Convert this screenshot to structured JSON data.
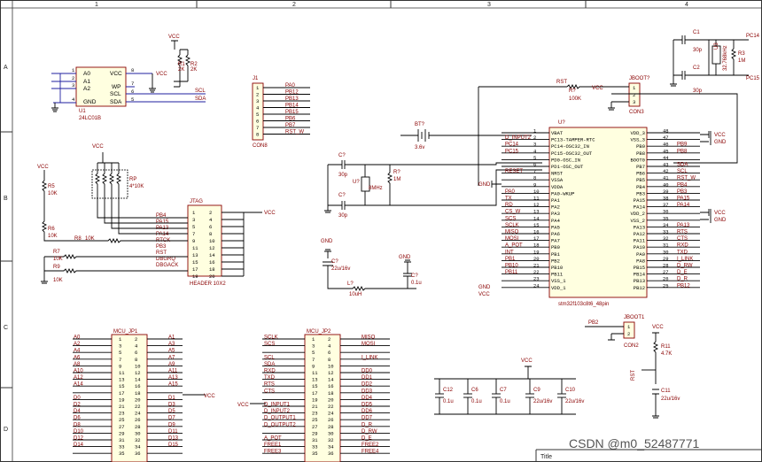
{
  "frame": {
    "col_labels": [
      "1",
      "2",
      "3",
      "4"
    ],
    "row_labels": [
      "A",
      "B",
      "C",
      "D"
    ],
    "title_label": "Title"
  },
  "watermark": "CSDN @m0_52487771",
  "eeprom": {
    "ref": "U1",
    "part": "24LC01B",
    "pins_left": [
      "A0",
      "A1",
      "A2",
      "GND"
    ],
    "pins_right": [
      "VCC",
      "WP",
      "SCL",
      "SDA"
    ],
    "pin_nums": [
      "1",
      "2",
      "3",
      "4",
      "8",
      "7",
      "6",
      "5"
    ],
    "r1": "R1",
    "r1v": "2K",
    "r2": "R2",
    "r2v": "2K",
    "nets": [
      "SCL",
      "SDA"
    ],
    "vcc": "VCC",
    "vcc2": "VCC"
  },
  "j1": {
    "ref": "J1",
    "part": "CON8",
    "pins": [
      "1",
      "2",
      "3",
      "4",
      "5",
      "6",
      "7",
      "8"
    ],
    "nets": [
      "PA0",
      "PB12",
      "PB13",
      "PB14",
      "PB15",
      "PB6",
      "PB7",
      "RST_W"
    ]
  },
  "battery": {
    "ref": "BT?",
    "value": "3.6v"
  },
  "crystal32": {
    "c1": "C1",
    "c1v": "30p",
    "c2": "C2",
    "c2v": "30p",
    "y": "U3",
    "yv": "32.768kHz",
    "r": "R3",
    "rv": "1M",
    "nets": [
      "PC14",
      "PC15"
    ]
  },
  "crystal8": {
    "c1": "C?",
    "c1v": "30p",
    "c2": "C?",
    "c2v": "30p",
    "y": "U?",
    "yv": "8MHz",
    "r": "R?",
    "rv": "1M"
  },
  "boot": {
    "ref": "JBOOT?",
    "part": "CON3",
    "r": "R?",
    "rv": "100K",
    "rst": "RST",
    "pins": [
      "1",
      "2",
      "3"
    ],
    "vcc": "VCC",
    "gnd": "GND"
  },
  "boot1": {
    "ref": "JBOOT1",
    "part": "CON2",
    "net": "PB2",
    "pins": [
      "1",
      "2"
    ]
  },
  "mcu": {
    "ref": "U?",
    "part": "stm32f103c8t6_48pin",
    "left_pins": [
      "VBAT",
      "PC13-TAMPER-RTC",
      "PC14-OSC32_IN",
      "PC15-OSC32_OUT",
      "PD0-OSC_IN",
      "PD1-OSC_OUT",
      "NRST",
      "VSSA",
      "VDDA",
      "PA0-WKUP",
      "PA1",
      "PA2",
      "PA3",
      "PA4",
      "PA5",
      "PA6",
      "PA7",
      "PB0",
      "PB1",
      "PB2",
      "PB10",
      "PB11",
      "VSS_1",
      "VDD_1"
    ],
    "left_nums": [
      "1",
      "2",
      "3",
      "4",
      "5",
      "6",
      "7",
      "8",
      "9",
      "10",
      "11",
      "12",
      "13",
      "14",
      "15",
      "16",
      "17",
      "18",
      "19",
      "20",
      "21",
      "22",
      "23",
      "24"
    ],
    "left_nets": [
      "",
      "D_INPUT2",
      "PC14",
      "PC15",
      "",
      "",
      "RESET",
      "",
      "",
      "PA0",
      "TX",
      "RD",
      "CS_W",
      "SCS",
      "SCLK",
      "MISO",
      "MOSI",
      "A_POT",
      "INT",
      "PB1",
      "PB10",
      "PB11",
      "",
      ""
    ],
    "right_pins": [
      "VDD_3",
      "VSS_3",
      "PB9",
      "PB8",
      "BOOT0",
      "PB7",
      "PB6",
      "PB5",
      "PB4",
      "PB3",
      "PA15",
      "PA14",
      "VDD_2",
      "VSS_2",
      "PA13",
      "PA12",
      "PA11",
      "PA10",
      "PA9",
      "PA8",
      "PB15",
      "PB14",
      "PB13",
      "PB12"
    ],
    "right_nums": [
      "48",
      "47",
      "46",
      "45",
      "44",
      "43",
      "42",
      "41",
      "40",
      "39",
      "38",
      "37",
      "36",
      "35",
      "34",
      "33",
      "32",
      "31",
      "30",
      "29",
      "28",
      "27",
      "26",
      "25"
    ],
    "right_nets": [
      "",
      "",
      "PB9",
      "PB8",
      "",
      "SDA",
      "SCL",
      "RST_W",
      "PB4",
      "PB3",
      "PA15",
      "PA14",
      "",
      "",
      "PA13",
      "RTS",
      "CTS",
      "RXD",
      "TXD",
      "I_LINK",
      "D_RW",
      "D_E",
      "D_R",
      "PB12"
    ],
    "vcc": "VCC",
    "gnd": "GND"
  },
  "jtag": {
    "ref": "JTAG",
    "part": "HEADER 10X2",
    "rp": "RP",
    "rpv": "4*10K",
    "r5": "R5",
    "r5v": "10K",
    "r6": "R6",
    "r6v": "10K",
    "r7": "R7",
    "r7v": "10K",
    "r8": "R8",
    "r8v": "10K",
    "r9": "R9",
    "r9v": "10K",
    "nets": [
      "PB4",
      "PA15",
      "PA13",
      "PA14",
      "RTCK",
      "PB3",
      "RST",
      "DBGRQ",
      "DBGACK"
    ],
    "nums_l": [
      "1",
      "3",
      "5",
      "7",
      "9",
      "11",
      "13",
      "15",
      "17",
      "19"
    ],
    "nums_r": [
      "2",
      "4",
      "6",
      "8",
      "10",
      "12",
      "14",
      "16",
      "18",
      "20"
    ],
    "vcc": "VCC",
    "vcc2": "VCC"
  },
  "filter": {
    "c": "C?",
    "cv": "22u/16v",
    "l": "L?",
    "lv": "10uH",
    "c2": "C?",
    "c2v": "0.1u",
    "gnd": "GND",
    "gnd2": "GND"
  },
  "mcu_jp1": {
    "ref": "MCU_JP1",
    "left_nets": [
      "A0",
      "A2",
      "A4",
      "A6",
      "A8",
      "A10",
      "A12",
      "A14",
      "",
      "D0",
      "D2",
      "D4",
      "D6",
      "D8",
      "D10",
      "D12",
      "D14",
      ""
    ],
    "left_nums": [
      "1",
      "3",
      "5",
      "7",
      "9",
      "11",
      "13",
      "15",
      "17",
      "19",
      "21",
      "23",
      "25",
      "27",
      "29",
      "31",
      "33",
      "35"
    ],
    "right_nums": [
      "2",
      "4",
      "6",
      "8",
      "10",
      "12",
      "14",
      "16",
      "18",
      "20",
      "22",
      "24",
      "26",
      "28",
      "30",
      "32",
      "34",
      "36"
    ],
    "right_nets": [
      "A1",
      "A3",
      "A5",
      "A7",
      "A9",
      "A11",
      "A13",
      "A15",
      "",
      "D1",
      "D3",
      "D5",
      "D7",
      "D9",
      "D11",
      "D13",
      "D15",
      ""
    ],
    "vcc": "VCC"
  },
  "mcu_jp2": {
    "ref": "MCU_JP2",
    "left_nets": [
      "SCLK",
      "SCS",
      "",
      "SCL",
      "SDA",
      "RXD",
      "TXD",
      "RTS",
      "CTS",
      "",
      "D_INPUT1",
      "D_INPUT2",
      "D_OUTPUT1",
      "D_OUTPUT2",
      "",
      "A_POT",
      "FREE1",
      "FREE3"
    ],
    "left_nums": [
      "1",
      "3",
      "5",
      "7",
      "9",
      "11",
      "13",
      "15",
      "17",
      "19",
      "21",
      "23",
      "25",
      "27",
      "29",
      "31",
      "33",
      "35"
    ],
    "right_nums": [
      "2",
      "4",
      "6",
      "8",
      "10",
      "12",
      "14",
      "16",
      "18",
      "20",
      "22",
      "24",
      "26",
      "28",
      "30",
      "32",
      "34",
      "36"
    ],
    "right_nets": [
      "MISO",
      "MOSI",
      "",
      "I_LINK",
      "",
      "DD0",
      "DD1",
      "DD2",
      "DD3",
      "DD4",
      "DD5",
      "DD6",
      "DD7",
      "D_R",
      "D_RW",
      "D_E",
      "FREE2",
      "FREE4"
    ],
    "vcc": "VCC"
  },
  "decoupling": {
    "caps": [
      "C12",
      "C6",
      "C7",
      "C9",
      "C10"
    ],
    "vals": [
      "0.1u",
      "0.1u",
      "0.1u",
      "22u/16v",
      "22u/16v"
    ],
    "vcc": "VCC"
  },
  "reset": {
    "r": "R11",
    "rv": "4.7K",
    "c": "C11",
    "cv": "22u/16v",
    "net": "RST",
    "vcc": "VCC"
  }
}
